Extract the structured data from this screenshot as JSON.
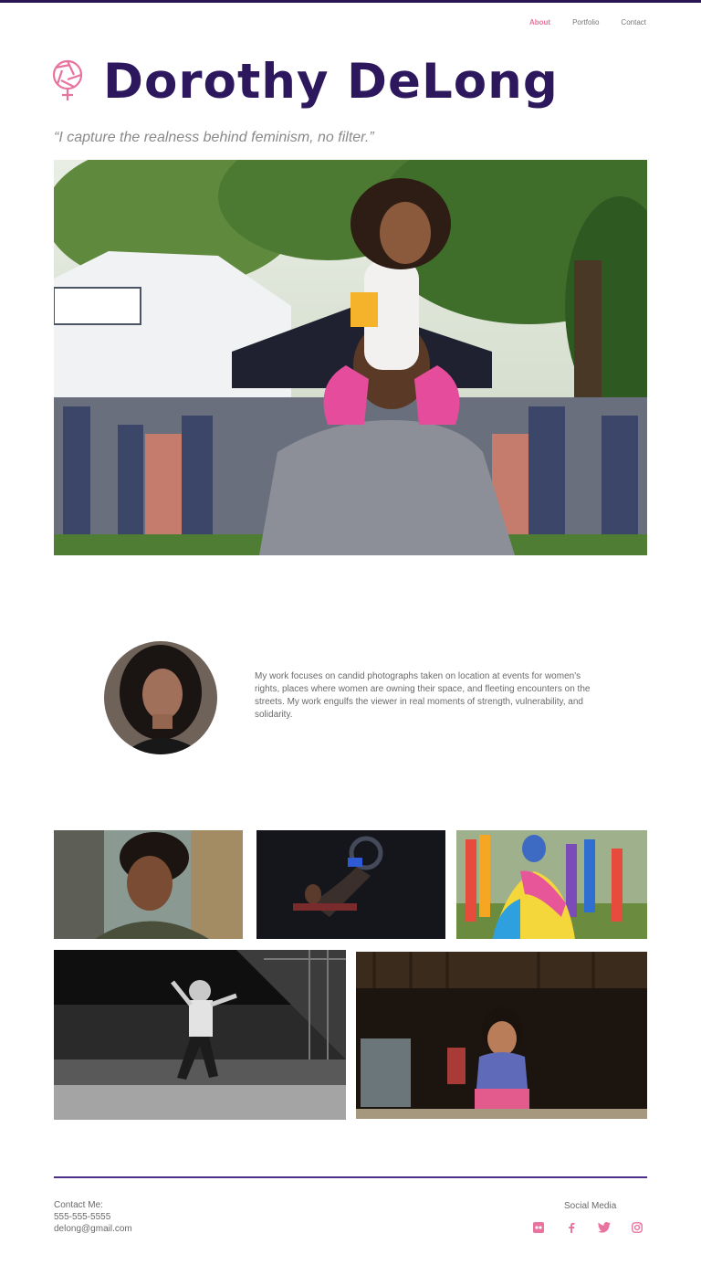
{
  "nav": {
    "items": [
      {
        "label": "About",
        "active": true
      },
      {
        "label": "Portfolio",
        "active": false
      },
      {
        "label": "Contact",
        "active": false
      }
    ]
  },
  "header": {
    "name": "Dorothy DeLong",
    "logo_icon": "aperture-venus-icon",
    "tagline": "“I capture the realness behind feminism, no filter.”"
  },
  "hero": {
    "image": "father-carrying-daughter-on-shoulders-at-festival-photo"
  },
  "about": {
    "avatar": "portrait-of-woman-with-curly-hair-photo",
    "text": "My work focuses on candid photographs taken on location at events for women's rights, places where women are owning their space, and fleeting encounters on the streets. My work engulfs the viewer in real moments of strength, vulnerability, and solidarity."
  },
  "gallery": [
    {
      "image": "laughing-woman-with-earphones-photo"
    },
    {
      "image": "dark-gym-workout-photo"
    },
    {
      "image": "woman-wrapped-in-pride-flag-photo"
    },
    {
      "image": "black-and-white-concert-dancer-photo"
    },
    {
      "image": "smiling-girl-in-dark-room-photo"
    }
  ],
  "footer": {
    "contact_label": "Contact Me:",
    "phone": "555-555-5555",
    "email": "delong@gmail.com",
    "social_label": "Social Media",
    "social_icons": [
      "flickr-icon",
      "facebook-icon",
      "twitter-icon",
      "instagram-icon"
    ]
  },
  "colors": {
    "brand": "#2d175d",
    "accent": "#e8739f",
    "rule": "#4b2e87"
  }
}
